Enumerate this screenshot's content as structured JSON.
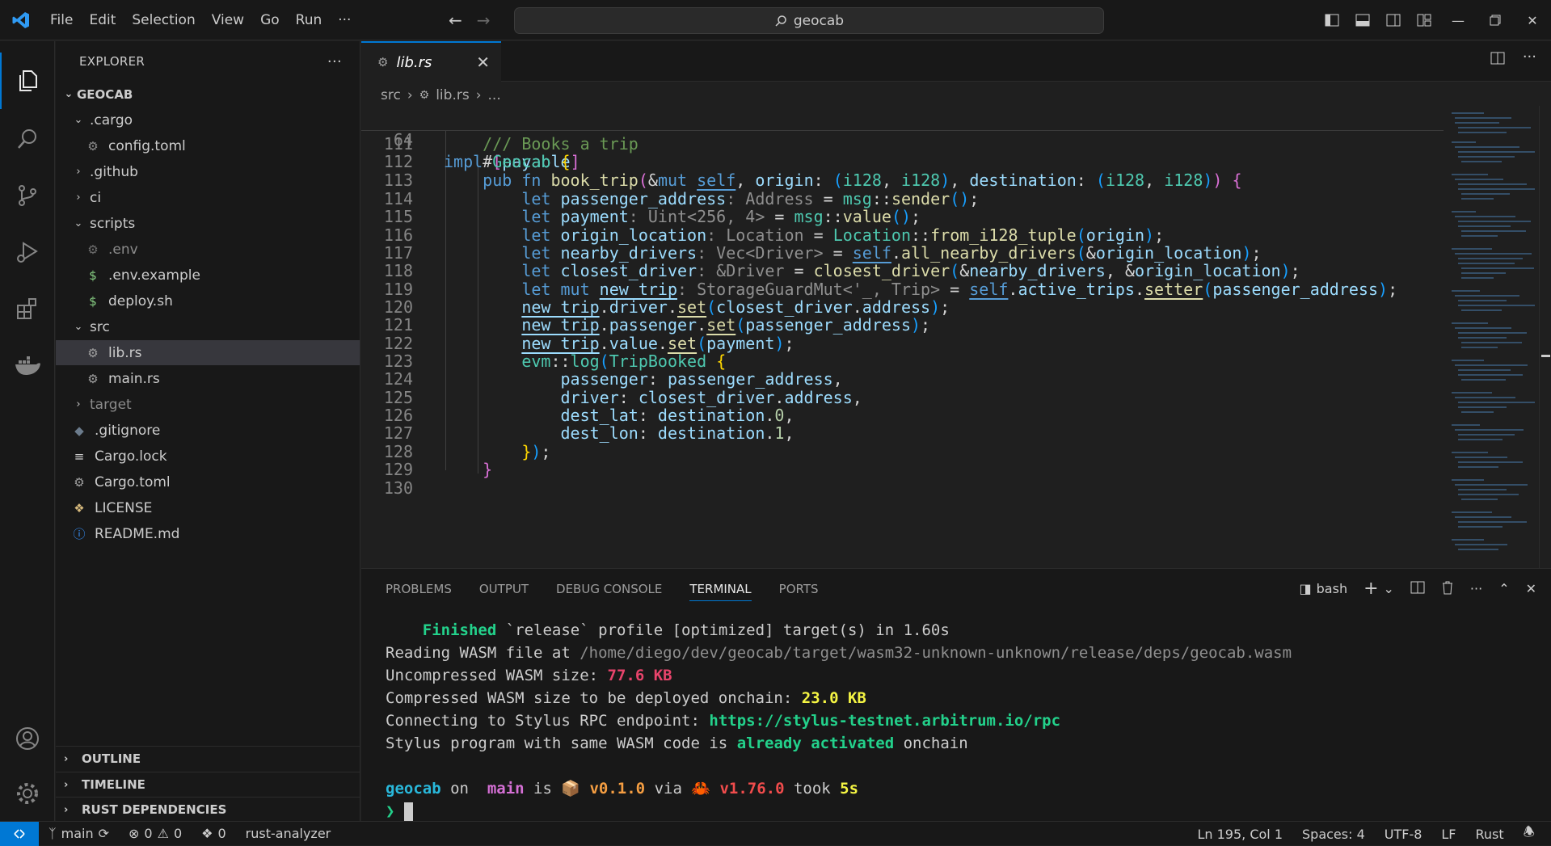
{
  "app": {
    "search_text": "geocab",
    "accent": "#0078d4"
  },
  "menu": [
    "File",
    "Edit",
    "Selection",
    "View",
    "Go",
    "Run",
    "···"
  ],
  "explorer": {
    "title": "EXPLORER",
    "more": "···",
    "root": "GEOCAB",
    "items": [
      {
        "label": ".cargo",
        "kind": "folder-open"
      },
      {
        "label": "config.toml",
        "kind": "gear"
      },
      {
        "label": ".github",
        "kind": "folder"
      },
      {
        "label": "ci",
        "kind": "folder"
      },
      {
        "label": "scripts",
        "kind": "folder-open"
      },
      {
        "label": ".env",
        "kind": "gear"
      },
      {
        "label": ".env.example",
        "kind": "dollar"
      },
      {
        "label": "deploy.sh",
        "kind": "dollar"
      },
      {
        "label": "src",
        "kind": "folder-open"
      },
      {
        "label": "lib.rs",
        "kind": "rust"
      },
      {
        "label": "main.rs",
        "kind": "rust"
      },
      {
        "label": "target",
        "kind": "folder"
      },
      {
        "label": ".gitignore",
        "kind": "git"
      },
      {
        "label": "Cargo.lock",
        "kind": "lines"
      },
      {
        "label": "Cargo.toml",
        "kind": "gear"
      },
      {
        "label": "LICENSE",
        "kind": "license"
      },
      {
        "label": "README.md",
        "kind": "info"
      }
    ],
    "sections": [
      "OUTLINE",
      "TIMELINE",
      "RUST DEPENDENCIES"
    ]
  },
  "tab": {
    "label": "lib.rs",
    "close": "✕"
  },
  "breadcrumb": {
    "src": "src",
    "file": "lib.rs",
    "rest": "..."
  },
  "editor": {
    "sticky_line": "64",
    "sticky_impl": "impl",
    "sticky_name": "Geocab",
    "sticky_brace": "{",
    "line_numbers": [
      "111",
      "112",
      "113",
      "114",
      "115",
      "116",
      "117",
      "118",
      "119",
      "120",
      "121",
      "122",
      "123",
      "124",
      "125",
      "126",
      "127",
      "128",
      "129",
      "130"
    ]
  },
  "panel": {
    "tabs": [
      "PROBLEMS",
      "OUTPUT",
      "DEBUG CONSOLE",
      "TERMINAL",
      "PORTS"
    ],
    "shell": "bash",
    "terminal": {
      "finished_word": "Finished",
      "finished_rest": " `release` profile [optimized] target(s) in 1.60s",
      "reading_label": "Reading WASM file at ",
      "reading_path": "/home/diego/dev/geocab/target/wasm32-unknown-unknown/release/deps/geocab.wasm",
      "uncompressed_label": "Uncompressed WASM size: ",
      "uncompressed_value": "77.6 KB",
      "compressed_label": "Compressed WASM size to be deployed onchain: ",
      "compressed_value": "23.0 KB",
      "connecting_label": "Connecting to Stylus RPC endpoint: ",
      "rpc_url": "https://stylus-testnet.arbitrum.io/rpc",
      "activated_pre": "Stylus program with same WASM code is ",
      "activated_word": "already activated",
      "activated_post": " onchain",
      "prompt_dir": "geocab",
      "prompt_on": " on ",
      "prompt_branch": " main",
      "prompt_is": " is ",
      "prompt_pkg_icon": "📦",
      "prompt_version": " v0.1.0",
      "prompt_via": " via ",
      "prompt_rust_icon": "🦀",
      "prompt_rust": " v1.76.0",
      "prompt_took": " took ",
      "prompt_time": "5s",
      "prompt_char": "❯"
    }
  },
  "status": {
    "branch": "main",
    "errors": "0",
    "warnings": "0",
    "ports": "0",
    "analyzer": "rust-analyzer",
    "position": "Ln 195, Col 1",
    "spaces": "Spaces: 4",
    "encoding": "UTF-8",
    "eol": "LF",
    "language": "Rust"
  }
}
